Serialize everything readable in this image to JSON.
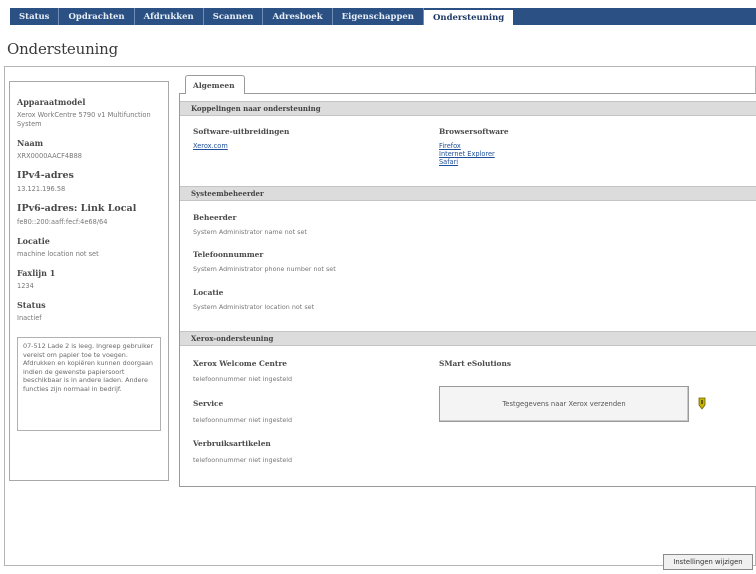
{
  "nav": {
    "tabs": [
      "Status",
      "Opdrachten",
      "Afdrukken",
      "Scannen",
      "Adresboek",
      "Eigenschappen",
      "Ondersteuning"
    ],
    "active_index": 6
  },
  "page": {
    "title": "Ondersteuning"
  },
  "sidebar": {
    "model_label": "Apparaatmodel",
    "model_value": "Xerox WorkCentre 5790 v1 Multifunction System",
    "name_label": "Naam",
    "name_value": "XRX0000AACF4B88",
    "ipv4_label": "IPv4-adres",
    "ipv4_value": "13.121.196.58",
    "ipv6_label": "IPv6-adres: Link Local",
    "ipv6_value": "fe80::200:aaff:fecf:4e68/64",
    "location_label": "Locatie",
    "location_value": "machine location not set",
    "fax_label": "Faxlijn 1",
    "fax_value": "1234",
    "status_label": "Status",
    "status_value": "Inactief",
    "status_message": "07-512 Lade 2 is leeg. Ingreep gebruiker vereist om papier toe te voegen. Afdrukken en kopiëren kunnen doorgaan indien de gewenste papiersoort beschikbaar is in andere laden. Andere functies zijn normaal in bedrijf."
  },
  "tab": {
    "label": "Algemeen"
  },
  "links_section": {
    "header": "Koppelingen naar ondersteuning",
    "software_title": "Software-uitbreidingen",
    "software_link": "Xerox.com",
    "browser_title": "Browsersoftware",
    "browser_links": [
      "Firefox",
      "Internet Explorer",
      "Safari"
    ]
  },
  "admin_section": {
    "header": "Systeembeheerder",
    "admin_title": "Beheerder",
    "admin_value": "System Administrator name not set",
    "phone_title": "Telefoonnummer",
    "phone_value": "System Administrator phone number not set",
    "location_title": "Locatie",
    "location_value": "System Administrator location not set"
  },
  "xerox_section": {
    "header": "Xerox-ondersteuning",
    "welcome_title": "Xerox Welcome Centre",
    "welcome_value": "telefoonnummer niet ingesteld",
    "service_title": "Service",
    "service_value": "telefoonnummer niet ingesteld",
    "supplies_title": "Verbruiksartikelen",
    "supplies_value": "telefoonnummer niet ingesteld",
    "smart_title": "SMart eSolutions",
    "send_button": "Testgegevens naar Xerox verzenden"
  },
  "footer": {
    "apply_button": "Instellingen wijzigen"
  },
  "colors": {
    "nav_bg": "#2b5184",
    "section_bg": "#dcdcdc",
    "link": "#1f4f9a",
    "icon": "#c8b400"
  },
  "icons": {
    "info": "info-tag-icon"
  }
}
